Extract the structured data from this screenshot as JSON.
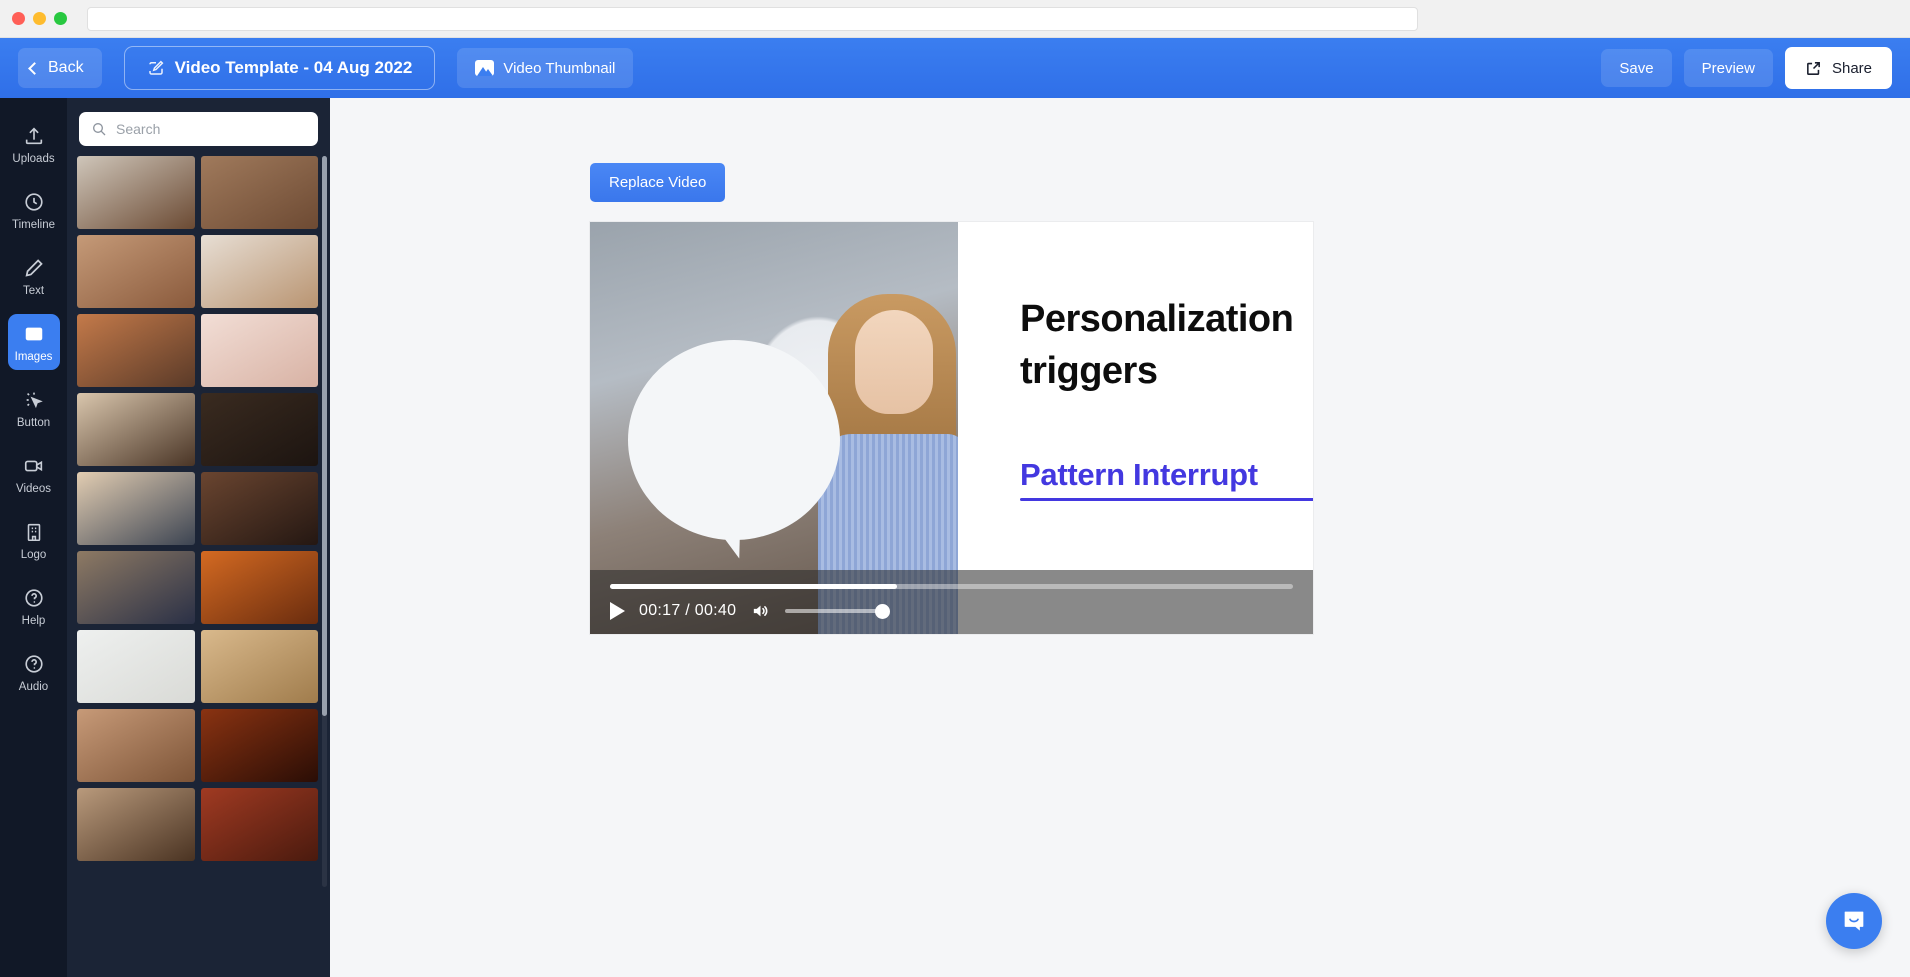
{
  "browser": {
    "url_value": "",
    "url_placeholder": ""
  },
  "topbar": {
    "back_label": "Back",
    "project_title": "Video Template - 04 Aug 2022",
    "thumbnail_tab_label": "Video Thumbnail",
    "save_label": "Save",
    "preview_label": "Preview",
    "share_label": "Share",
    "accent_color": "#3b7ef0"
  },
  "rail": {
    "items": [
      {
        "label": "Uploads",
        "icon": "upload-icon",
        "active": false
      },
      {
        "label": "Timeline",
        "icon": "clock-icon",
        "active": false
      },
      {
        "label": "Text",
        "icon": "pencil-icon",
        "active": false
      },
      {
        "label": "Images",
        "icon": "image-icon",
        "active": true
      },
      {
        "label": "Button",
        "icon": "cursor-click-icon",
        "active": false
      },
      {
        "label": "Videos",
        "icon": "video-camera-icon",
        "active": false
      },
      {
        "label": "Logo",
        "icon": "building-icon",
        "active": false
      },
      {
        "label": "Help",
        "icon": "question-circle-icon",
        "active": false
      },
      {
        "label": "Audio",
        "icon": "question-circle-icon",
        "active": false
      }
    ]
  },
  "panel": {
    "search_placeholder": "Search",
    "search_value": "",
    "thumbnails": [
      {
        "name": "gingerbread-cookies",
        "c1": "#cfc6ba",
        "c2": "#6b4a33"
      },
      {
        "name": "petra-ruins",
        "c1": "#a07a5c",
        "c2": "#6d4a33"
      },
      {
        "name": "canyon-hiker",
        "c1": "#c59a78",
        "c2": "#8a5a3c"
      },
      {
        "name": "breakfast-in-bed",
        "c1": "#e7ded4",
        "c2": "#b99471"
      },
      {
        "name": "market-street",
        "c1": "#c47a4a",
        "c2": "#5a3a28"
      },
      {
        "name": "dont-be-more-tee",
        "c1": "#f2ded6",
        "c2": "#d8b2a4"
      },
      {
        "name": "cafe-terrace",
        "c1": "#d9c6ad",
        "c2": "#4a3526"
      },
      {
        "name": "takeaway-shop",
        "c1": "#3a2b20",
        "c2": "#1c1410"
      },
      {
        "name": "flower-door",
        "c1": "#e2cdb2",
        "c2": "#3c4452"
      },
      {
        "name": "antique-interior",
        "c1": "#6a4530",
        "c2": "#241712"
      },
      {
        "name": "portrait-resting",
        "c1": "#8e7a64",
        "c2": "#2a3046"
      },
      {
        "name": "amber-corridor",
        "c1": "#d46a22",
        "c2": "#6a2c0e"
      },
      {
        "name": "foggy-shoreline",
        "c1": "#eef0ef",
        "c2": "#d9dad6"
      },
      {
        "name": "old-book-pages",
        "c1": "#d9b98c",
        "c2": "#a07c4c"
      },
      {
        "name": "autumn-house",
        "c1": "#c79a78",
        "c2": "#7d5437"
      },
      {
        "name": "lantern-night",
        "c1": "#8a3312",
        "c2": "#2a0d05"
      },
      {
        "name": "vintage-shelf",
        "c1": "#b99a7c",
        "c2": "#4a3322"
      },
      {
        "name": "red-fabric",
        "c1": "#a03a22",
        "c2": "#4a1a0e"
      }
    ]
  },
  "canvas": {
    "replace_button_label": "Replace Video",
    "slide": {
      "heading": "Personalization triggers",
      "subheading": "Pattern Interrupt",
      "subheading_color": "#4338e0"
    },
    "player": {
      "current_time": "00:17",
      "duration": "00:40",
      "timecode": "00:17 / 00:40",
      "progress_percent": 42,
      "volume_percent": 100,
      "play_icon": "play-icon",
      "volume_icon": "volume-icon"
    },
    "intercom_icon": "chat-bubble-icon"
  }
}
